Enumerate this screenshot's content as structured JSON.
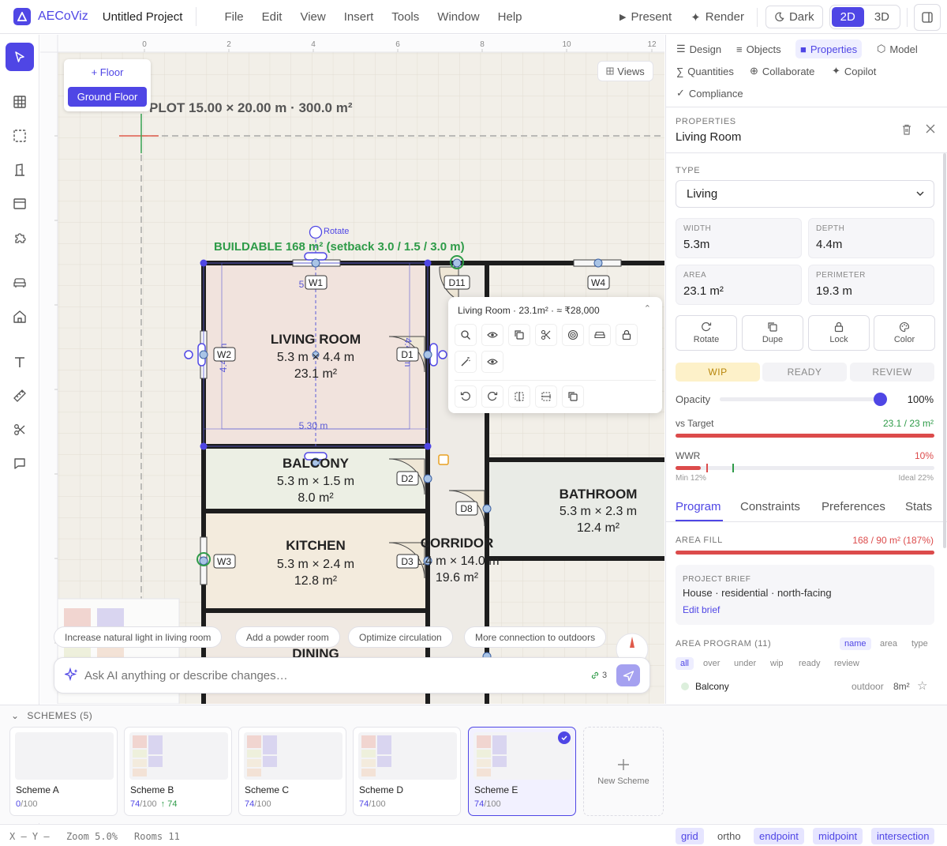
{
  "topbar": {
    "app_name": "AECoViz",
    "project_name": "Untitled Project",
    "menu": [
      "File",
      "Edit",
      "View",
      "Insert",
      "Tools",
      "Window",
      "Help"
    ],
    "present": "Present",
    "render": "Render",
    "theme": "Dark",
    "view_2d": "2D",
    "view_3d": "3D"
  },
  "canvas": {
    "ruler_ticks": [
      "0",
      "2",
      "4",
      "6",
      "8",
      "10",
      "12"
    ],
    "floor_add": "+ Floor",
    "floor_active": "Ground Floor",
    "views": "Views",
    "plot_label": "PLOT 15.00 × 20.00 m   ·   300.0 m²",
    "buildable_label": "BUILDABLE 168 m²  (setback 3.0 / 1.5 / 3.0 m)",
    "rotate": "Rotate",
    "dim_top": "5.30 m",
    "dim_bottom": "5.30 m",
    "dim_side": "4.40 m",
    "rooms": {
      "living": {
        "name": "LIVING ROOM",
        "dims": "5.3 m × 4.4 m",
        "area": "23.1 m²"
      },
      "balcony": {
        "name": "BALCONY",
        "dims": "5.3 m × 1.5 m",
        "area": "8.0 m²"
      },
      "kitchen": {
        "name": "KITCHEN",
        "dims": "5.3 m × 2.4 m",
        "area": "12.8 m²"
      },
      "corridor": {
        "name": "CORRIDOR",
        "dims": "1.4 m × 14.0 m",
        "area": "19.6 m²"
      },
      "bathroom": {
        "name": "BATHROOM",
        "dims": "5.3 m × 2.3 m",
        "area": "12.4 m²"
      },
      "dining": {
        "name": "DINING"
      }
    },
    "tags": {
      "w1": "W1",
      "w2": "W2",
      "w3": "W3",
      "w4": "W4",
      "d1": "D1",
      "d2": "D2",
      "d3": "D3",
      "d8": "D8",
      "d11": "D11"
    },
    "popover": {
      "title": "Living Room · 23.1m² · ≈ ₹28,000"
    },
    "suggestions": [
      "Increase natural light in living room",
      "Add a powder room",
      "Optimize circulation",
      "More connection to outdoors"
    ],
    "ask_placeholder": "Ask AI anything or describe changes…",
    "ask_link_count": "3"
  },
  "rpanel": {
    "tabs": [
      "Design",
      "Objects",
      "Properties",
      "Model",
      "Quantities",
      "Collaborate",
      "Copilot",
      "Compliance"
    ],
    "properties_label": "PROPERTIES",
    "selected_name": "Living Room",
    "type_label": "TYPE",
    "type_value": "Living",
    "width_label": "WIDTH",
    "width_value": "5.3m",
    "depth_label": "DEPTH",
    "depth_value": "4.4m",
    "area_label": "AREA",
    "area_value": "23.1 m²",
    "perimeter_label": "PERIMETER",
    "perimeter_value": "19.3 m",
    "actions": [
      "Rotate",
      "Dupe",
      "Lock",
      "Color"
    ],
    "status": [
      "WIP",
      "READY",
      "REVIEW"
    ],
    "opacity_label": "Opacity",
    "opacity_value": "100%",
    "opacity_level": 1.0,
    "vs_target_label": "vs Target",
    "vs_target_value": "23.1 / 23 m²",
    "wwr_label": "WWR",
    "wwr_value": "10%",
    "wwr_min": "Min 12%",
    "wwr_ideal": "Ideal 22%",
    "subtabs": [
      "Program",
      "Constraints",
      "Preferences",
      "Stats"
    ],
    "area_fill_label": "AREA FILL",
    "area_fill_value": "168 / 90 m² (187%)",
    "brief_label": "PROJECT BRIEF",
    "brief_text": "House · residential · north-facing",
    "brief_edit": "Edit brief",
    "program_label": "AREA PROGRAM (11)",
    "sort": [
      "name",
      "area",
      "type"
    ],
    "filters": [
      "all",
      "over",
      "under",
      "wip",
      "ready",
      "review"
    ],
    "program_row": {
      "name": "Balcony",
      "kind": "outdoor",
      "area": "8m²"
    }
  },
  "schemes": {
    "header": "SCHEMES (5)",
    "items": [
      {
        "name": "Scheme A",
        "score": "0",
        "max": "/100",
        "delta": ""
      },
      {
        "name": "Scheme B",
        "score": "74",
        "max": "/100",
        "delta": "↑ 74"
      },
      {
        "name": "Scheme C",
        "score": "74",
        "max": "/100",
        "delta": ""
      },
      {
        "name": "Scheme D",
        "score": "74",
        "max": "/100",
        "delta": ""
      },
      {
        "name": "Scheme E",
        "score": "74",
        "max": "/100",
        "delta": ""
      }
    ],
    "new_label": "New Scheme"
  },
  "status": {
    "coords": "X — Y —",
    "zoom": "Zoom 5.0%",
    "rooms": "Rooms 11",
    "snaps": [
      "grid",
      "ortho",
      "endpoint",
      "midpoint",
      "intersection"
    ]
  },
  "colors": {
    "accent": "#4f46e5",
    "danger": "#dc4b4b",
    "ok": "#2e9b48",
    "wip": "#fdf1c9"
  }
}
